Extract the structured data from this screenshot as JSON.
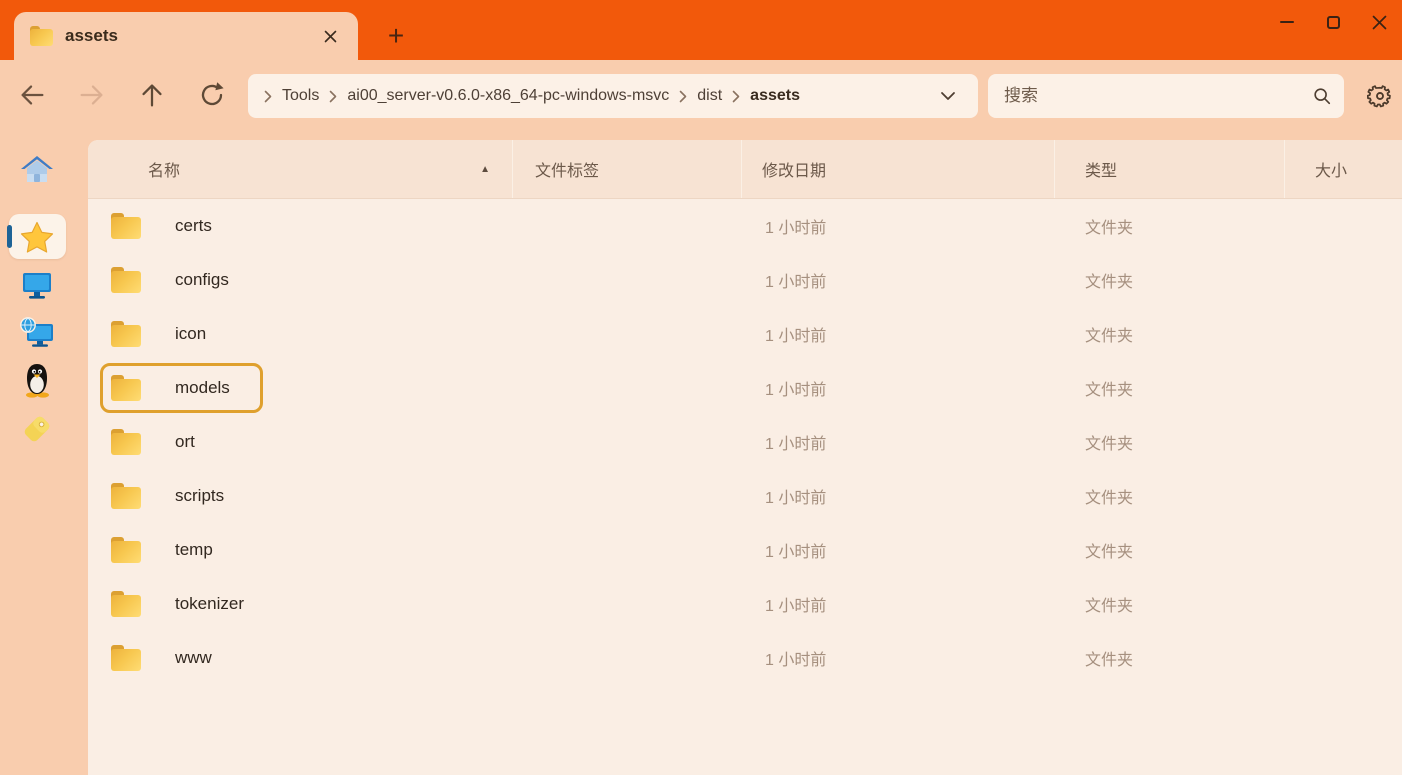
{
  "titlebar": {
    "tab_label": "assets",
    "new_tab_label": "+"
  },
  "toolbar": {
    "breadcrumb": [
      "Tools",
      "ai00_server-v0.6.0-x86_64-pc-windows-msvc",
      "dist",
      "assets"
    ],
    "search_placeholder": "搜索"
  },
  "sidebar": {
    "items": [
      {
        "id": "home",
        "icon": "home-icon",
        "selected": false
      },
      {
        "id": "starred",
        "icon": "star-icon",
        "selected": true
      },
      {
        "id": "this-pc",
        "icon": "monitor-icon",
        "selected": false
      },
      {
        "id": "network",
        "icon": "network-icon",
        "selected": false
      },
      {
        "id": "linux",
        "icon": "linux-penguin-icon",
        "selected": false
      },
      {
        "id": "tags",
        "icon": "tag-icon",
        "selected": false
      }
    ]
  },
  "main": {
    "columns": [
      {
        "key": "name",
        "label": "名称",
        "sort_indicator": "▲"
      },
      {
        "key": "tags",
        "label": "文件标签"
      },
      {
        "key": "modified",
        "label": "修改日期"
      },
      {
        "key": "type",
        "label": "类型"
      },
      {
        "key": "size",
        "label": "大小"
      }
    ],
    "rows": [
      {
        "name": "certs",
        "tags": "",
        "modified": "1 小时前",
        "type": "文件夹",
        "size": "",
        "selected": false
      },
      {
        "name": "configs",
        "tags": "",
        "modified": "1 小时前",
        "type": "文件夹",
        "size": "",
        "selected": false
      },
      {
        "name": "icon",
        "tags": "",
        "modified": "1 小时前",
        "type": "文件夹",
        "size": "",
        "selected": false
      },
      {
        "name": "models",
        "tags": "",
        "modified": "1 小时前",
        "type": "文件夹",
        "size": "",
        "selected": true
      },
      {
        "name": "ort",
        "tags": "",
        "modified": "1 小时前",
        "type": "文件夹",
        "size": "",
        "selected": false
      },
      {
        "name": "scripts",
        "tags": "",
        "modified": "1 小时前",
        "type": "文件夹",
        "size": "",
        "selected": false
      },
      {
        "name": "temp",
        "tags": "",
        "modified": "1 小时前",
        "type": "文件夹",
        "size": "",
        "selected": false
      },
      {
        "name": "tokenizer",
        "tags": "",
        "modified": "1 小时前",
        "type": "文件夹",
        "size": "",
        "selected": false
      },
      {
        "name": "www",
        "tags": "",
        "modified": "1 小时前",
        "type": "文件夹",
        "size": "",
        "selected": false
      }
    ]
  },
  "colors": {
    "titlebar": "#F2590B",
    "chrome": "#F9CDAE",
    "panel": "#FAEEE4",
    "panel_header": "#F7E3D3",
    "field": "#FCF1E7",
    "ink": "#33281F",
    "muted": "#A6907F",
    "label": "#6C594A",
    "selection": "#DFA02D",
    "indicator": "#1E6396"
  }
}
